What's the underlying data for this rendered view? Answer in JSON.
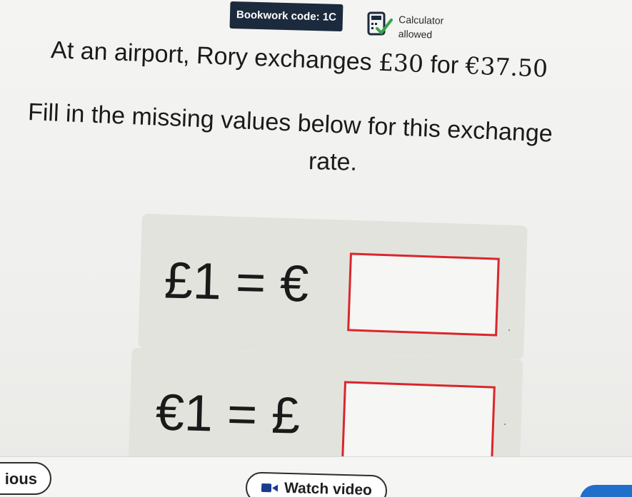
{
  "header": {
    "bookwork_code": "Bookwork code: 1C",
    "calculator_line1": "Calculator",
    "calculator_line2": "allowed",
    "calculator_icon": "calculator-check-icon"
  },
  "question": {
    "line1_prefix": "At an airport, Rory exchanges ",
    "line1_amount1": "£30",
    "line1_mid": " for ",
    "line1_amount2": "€37.50",
    "line2": "Fill in the missing values below for this exchange",
    "line3": "rate."
  },
  "equations": [
    {
      "lhs": "£1 = €",
      "answer_value": ""
    },
    {
      "lhs": "€1 = £",
      "answer_value": ""
    }
  ],
  "footer": {
    "previous_label": "ious",
    "watch_video_label": "Watch video",
    "watch_icon": "video-camera-icon"
  },
  "colors": {
    "answer_border": "#d9262b",
    "bookwork_bg": "#1b2a3d",
    "answer_tab": "#1f6fcb",
    "calculator_check": "#3aa14a"
  }
}
